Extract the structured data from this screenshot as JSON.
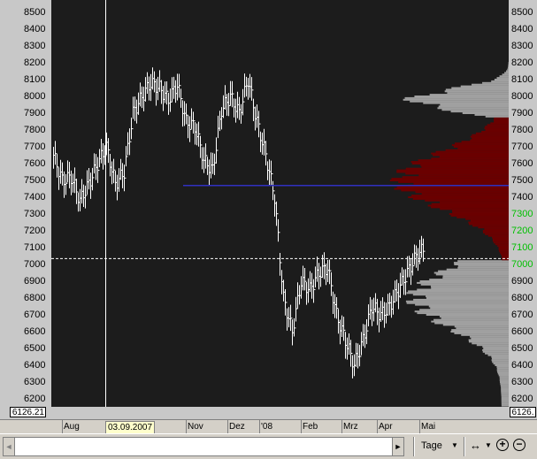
{
  "price_axis": {
    "ticks": [
      "8500",
      "8400",
      "8300",
      "8200",
      "8100",
      "8000",
      "7900",
      "7800",
      "7700",
      "7600",
      "7500",
      "7400",
      "7300",
      "7200",
      "7100",
      "7000",
      "6900",
      "6800",
      "6700",
      "6600",
      "6500",
      "6400",
      "6300",
      "6200"
    ],
    "highlight": [
      "7300",
      "7200",
      "7100",
      "7000"
    ],
    "current_left": "6126.21",
    "current_right": "6126."
  },
  "date_axis": {
    "months": [
      "Aug",
      "Nov",
      "Dez",
      "'08",
      "Feb",
      "Mrz",
      "Apr",
      "Mai"
    ],
    "cursor_date": "03.09.2007"
  },
  "toolbar": {
    "scroll_left_icon": "◄",
    "scroll_right_icon": "►",
    "timeframe": "Tage",
    "dropdown_icon": "▼",
    "pan_icon": "↔",
    "zoom_in_icon": "+",
    "zoom_out_icon": "−"
  },
  "colors": {
    "background": "#1c1c1c",
    "bars": "#ffffff",
    "profile_upper": "#a0a0a0",
    "profile_value_area": "#6a0000",
    "poc_line": "#3030c0",
    "crosshair": "#ffffff"
  },
  "chart_data": {
    "type": "ohlc",
    "y_ticks": [
      8500,
      8400,
      8300,
      8200,
      8100,
      8000,
      7900,
      7800,
      7700,
      7600,
      7500,
      7400,
      7300,
      7200,
      7100,
      7000,
      6900,
      6800,
      6700,
      6600,
      6500,
      6400,
      6300,
      6200
    ],
    "ylim": [
      6130,
      8560
    ],
    "current_price": 7035,
    "poc_price": 7470,
    "cursor_date": "03.09.2007",
    "months": [
      "Aug",
      "Nov",
      "Dez",
      "'08",
      "Feb",
      "Mrz",
      "Apr",
      "Mai"
    ],
    "series": [
      {
        "date": "2007-07-24",
        "close": 7650
      },
      {
        "date": "2007-07-31",
        "close": 7500
      },
      {
        "date": "2007-08-07",
        "close": 7520
      },
      {
        "date": "2007-08-14",
        "close": 7380
      },
      {
        "date": "2007-08-21",
        "close": 7480
      },
      {
        "date": "2007-08-28",
        "close": 7600
      },
      {
        "date": "2007-09-04",
        "close": 7700
      },
      {
        "date": "2007-09-11",
        "close": 7480
      },
      {
        "date": "2007-09-18",
        "close": 7550
      },
      {
        "date": "2007-09-25",
        "close": 7900
      },
      {
        "date": "2007-10-02",
        "close": 8000
      },
      {
        "date": "2007-10-09",
        "close": 8080
      },
      {
        "date": "2007-10-16",
        "close": 8050
      },
      {
        "date": "2007-10-23",
        "close": 7980
      },
      {
        "date": "2007-10-30",
        "close": 8070
      },
      {
        "date": "2007-11-06",
        "close": 7850
      },
      {
        "date": "2007-11-13",
        "close": 7820
      },
      {
        "date": "2007-11-20",
        "close": 7620
      },
      {
        "date": "2007-11-27",
        "close": 7560
      },
      {
        "date": "2007-12-04",
        "close": 7920
      },
      {
        "date": "2007-12-11",
        "close": 8000
      },
      {
        "date": "2007-12-18",
        "close": 7900
      },
      {
        "date": "2007-12-27",
        "close": 8100
      },
      {
        "date": "2008-01-03",
        "close": 7850
      },
      {
        "date": "2008-01-10",
        "close": 7650
      },
      {
        "date": "2008-01-17",
        "close": 7400
      },
      {
        "date": "2008-01-22",
        "close": 6800
      },
      {
        "date": "2008-01-29",
        "close": 6600
      },
      {
        "date": "2008-02-05",
        "close": 6900
      },
      {
        "date": "2008-02-12",
        "close": 6850
      },
      {
        "date": "2008-02-19",
        "close": 6950
      },
      {
        "date": "2008-02-26",
        "close": 6980
      },
      {
        "date": "2008-03-04",
        "close": 6700
      },
      {
        "date": "2008-03-11",
        "close": 6550
      },
      {
        "date": "2008-03-18",
        "close": 6400
      },
      {
        "date": "2008-03-25",
        "close": 6550
      },
      {
        "date": "2008-04-01",
        "close": 6750
      },
      {
        "date": "2008-04-08",
        "close": 6700
      },
      {
        "date": "2008-04-15",
        "close": 6750
      },
      {
        "date": "2008-04-22",
        "close": 6850
      },
      {
        "date": "2008-04-29",
        "close": 6950
      },
      {
        "date": "2008-05-06",
        "close": 7050
      },
      {
        "date": "2008-05-13",
        "close": 7100
      }
    ]
  }
}
